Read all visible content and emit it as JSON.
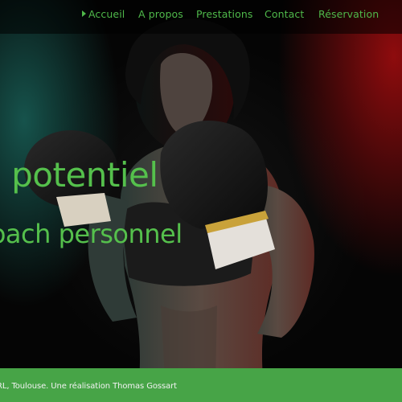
{
  "nav": {
    "items": [
      {
        "label": "Accueil",
        "active": true
      },
      {
        "label": "A propos"
      },
      {
        "label": "Prestations"
      },
      {
        "label": "Contact"
      },
      {
        "label": "Réservation"
      }
    ],
    "active_icon": "caret-right-icon"
  },
  "hero": {
    "headline": "ton potentiel",
    "subline": "Coach personnel"
  },
  "footer": {
    "text": "© SARRL, Toulouse. Une réalisation Thomas Gossart"
  },
  "colors": {
    "accent_green": "#4fb84a",
    "footer_green": "#47a447",
    "glow_teal": "#185c54",
    "glow_red": "#960c0e"
  }
}
